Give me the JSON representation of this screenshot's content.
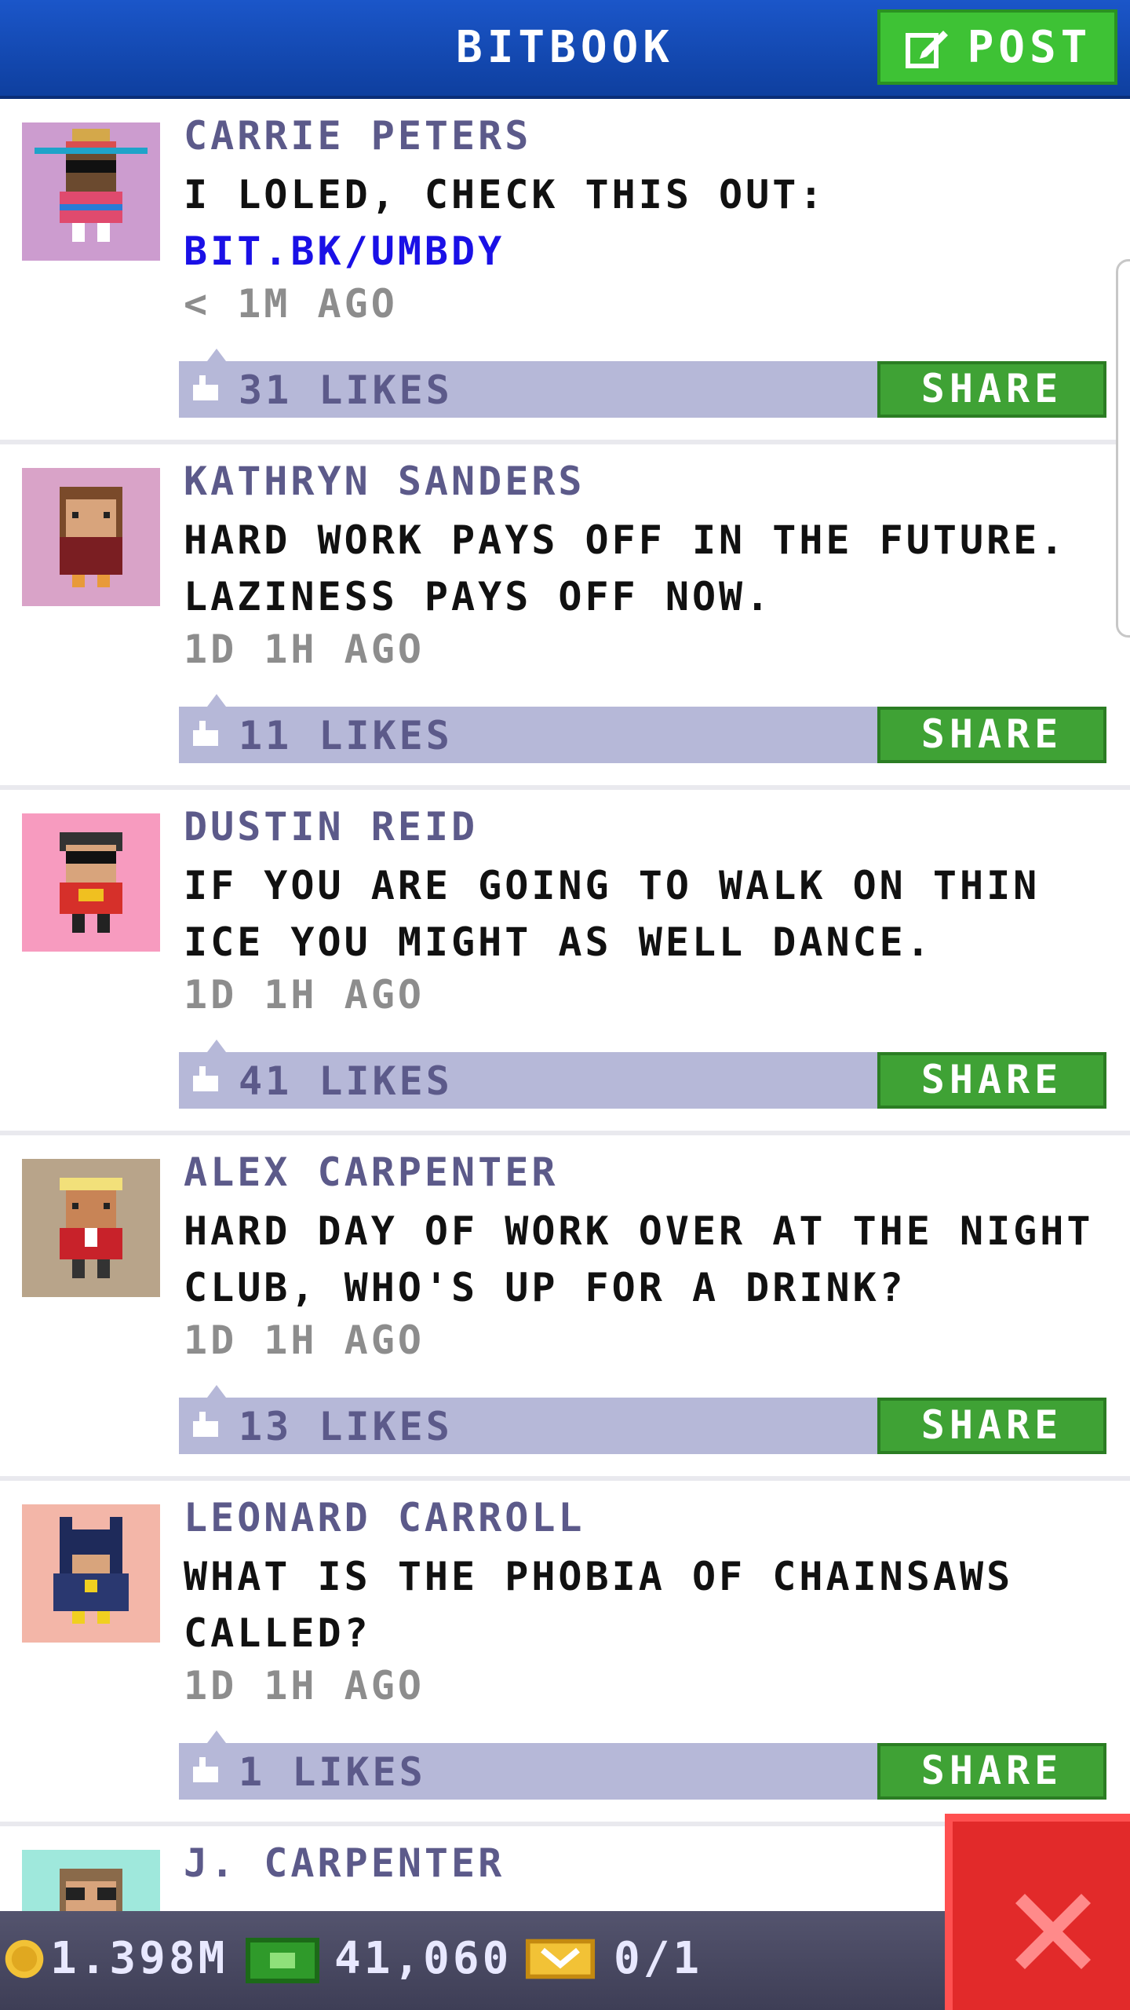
{
  "header": {
    "title": "BITBOOK",
    "post_button_label": "POST"
  },
  "posts": [
    {
      "author": "CARRIE PETERS",
      "text": "I LOLED, CHECK THIS OUT:",
      "link": "BIT.BK/UMBDY",
      "time": "< 1M AGO",
      "likes": "31 LIKES",
      "share_label": "SHARE"
    },
    {
      "author": "KATHRYN SANDERS",
      "text": "HARD WORK PAYS OFF IN THE FUTURE. LAZINESS PAYS OFF NOW.",
      "time": "1D 1H AGO",
      "likes": "11 LIKES",
      "share_label": "SHARE"
    },
    {
      "author": "DUSTIN REID",
      "text": "IF YOU ARE GOING TO WALK ON THIN ICE YOU MIGHT AS WELL DANCE.",
      "time": "1D 1H AGO",
      "likes": "41 LIKES",
      "share_label": "SHARE"
    },
    {
      "author": "ALEX CARPENTER",
      "text": "HARD DAY OF WORK OVER AT THE NIGHT CLUB, WHO'S UP FOR A DRINK?",
      "time": "1D 1H AGO",
      "likes": "13 LIKES",
      "share_label": "SHARE"
    },
    {
      "author": "LEONARD CARROLL",
      "text": "WHAT IS THE PHOBIA OF CHAINSAWS CALLED?",
      "time": "1D 1H AGO",
      "likes": "1 LIKES",
      "share_label": "SHARE"
    },
    {
      "author": "J. CARPENTER"
    }
  ],
  "status_bar": {
    "coins": "1.398M",
    "bux": "41,060",
    "tickets": "0/1"
  },
  "icons": {
    "post": "edit-icon",
    "like": "thumbs-up-icon",
    "coin": "coin-icon",
    "bux": "bux-icon",
    "ticket": "ticket-icon",
    "close": "close-icon"
  },
  "colors": {
    "header_blue": "#1b56c9",
    "button_green": "#3fa235",
    "likes_bar": "#b6b8d8",
    "author": "#5c5a8a",
    "link": "#1a10e6",
    "close_red": "#e22a2a"
  }
}
